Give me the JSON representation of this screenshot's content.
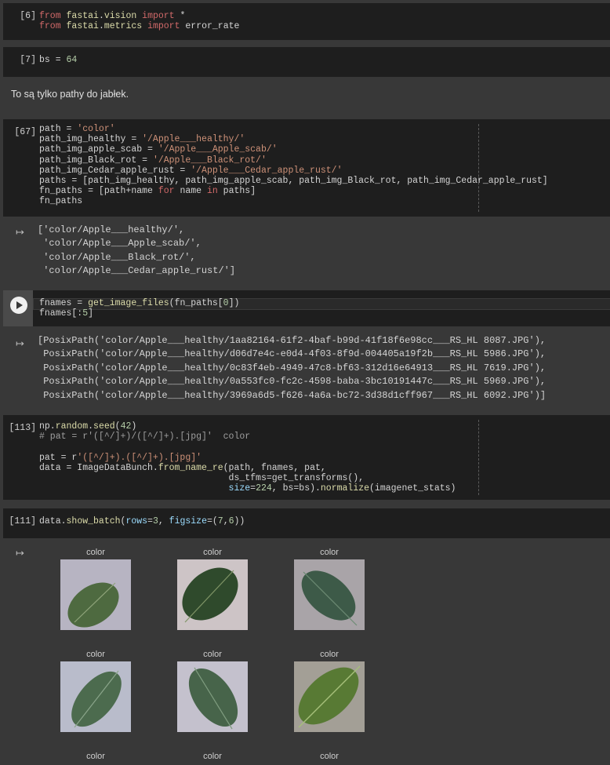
{
  "cells": {
    "c6": {
      "prompt": "[6]"
    },
    "c7": {
      "prompt": "[7]"
    },
    "c67": {
      "prompt": "[67]"
    },
    "crun": {
      "prompt": ""
    },
    "c113": {
      "prompt": "[113]"
    },
    "c111": {
      "prompt": "[111]"
    }
  },
  "markdown": {
    "text": "To są tylko pathy do jabłek."
  },
  "outputs": {
    "paths_list": [
      "['color/Apple___healthy/',",
      " 'color/Apple___Apple_scab/',",
      " 'color/Apple___Black_rot/',",
      " 'color/Apple___Cedar_apple_rust/']"
    ],
    "fnames_list": [
      "[PosixPath('color/Apple___healthy/1aa82164-61f2-4baf-b99d-41f18f6e98cc___RS_HL 8087.JPG'),",
      " PosixPath('color/Apple___healthy/d06d7e4c-e0d4-4f03-8f9d-004405a19f2b___RS_HL 5986.JPG'),",
      " PosixPath('color/Apple___healthy/0c83f4eb-4949-47c8-bf63-312d16e64913___RS_HL 7619.JPG'),",
      " PosixPath('color/Apple___healthy/0a553fc0-fc2c-4598-baba-3bc10191447c___RS_HL 5969.JPG'),",
      " PosixPath('color/Apple___healthy/3969a6d5-f626-4a6a-bc72-3d38d1cff967___RS_HL 6092.JPG')]"
    ]
  },
  "batch": {
    "labels": [
      "color",
      "color",
      "color",
      "color",
      "color",
      "color",
      "color",
      "color",
      "color"
    ]
  },
  "colors": {
    "page_bg": "#383838",
    "code_bg": "#1e1e1e",
    "keyword": "#c586c0",
    "string": "#ce9178",
    "number": "#b5cea8"
  }
}
